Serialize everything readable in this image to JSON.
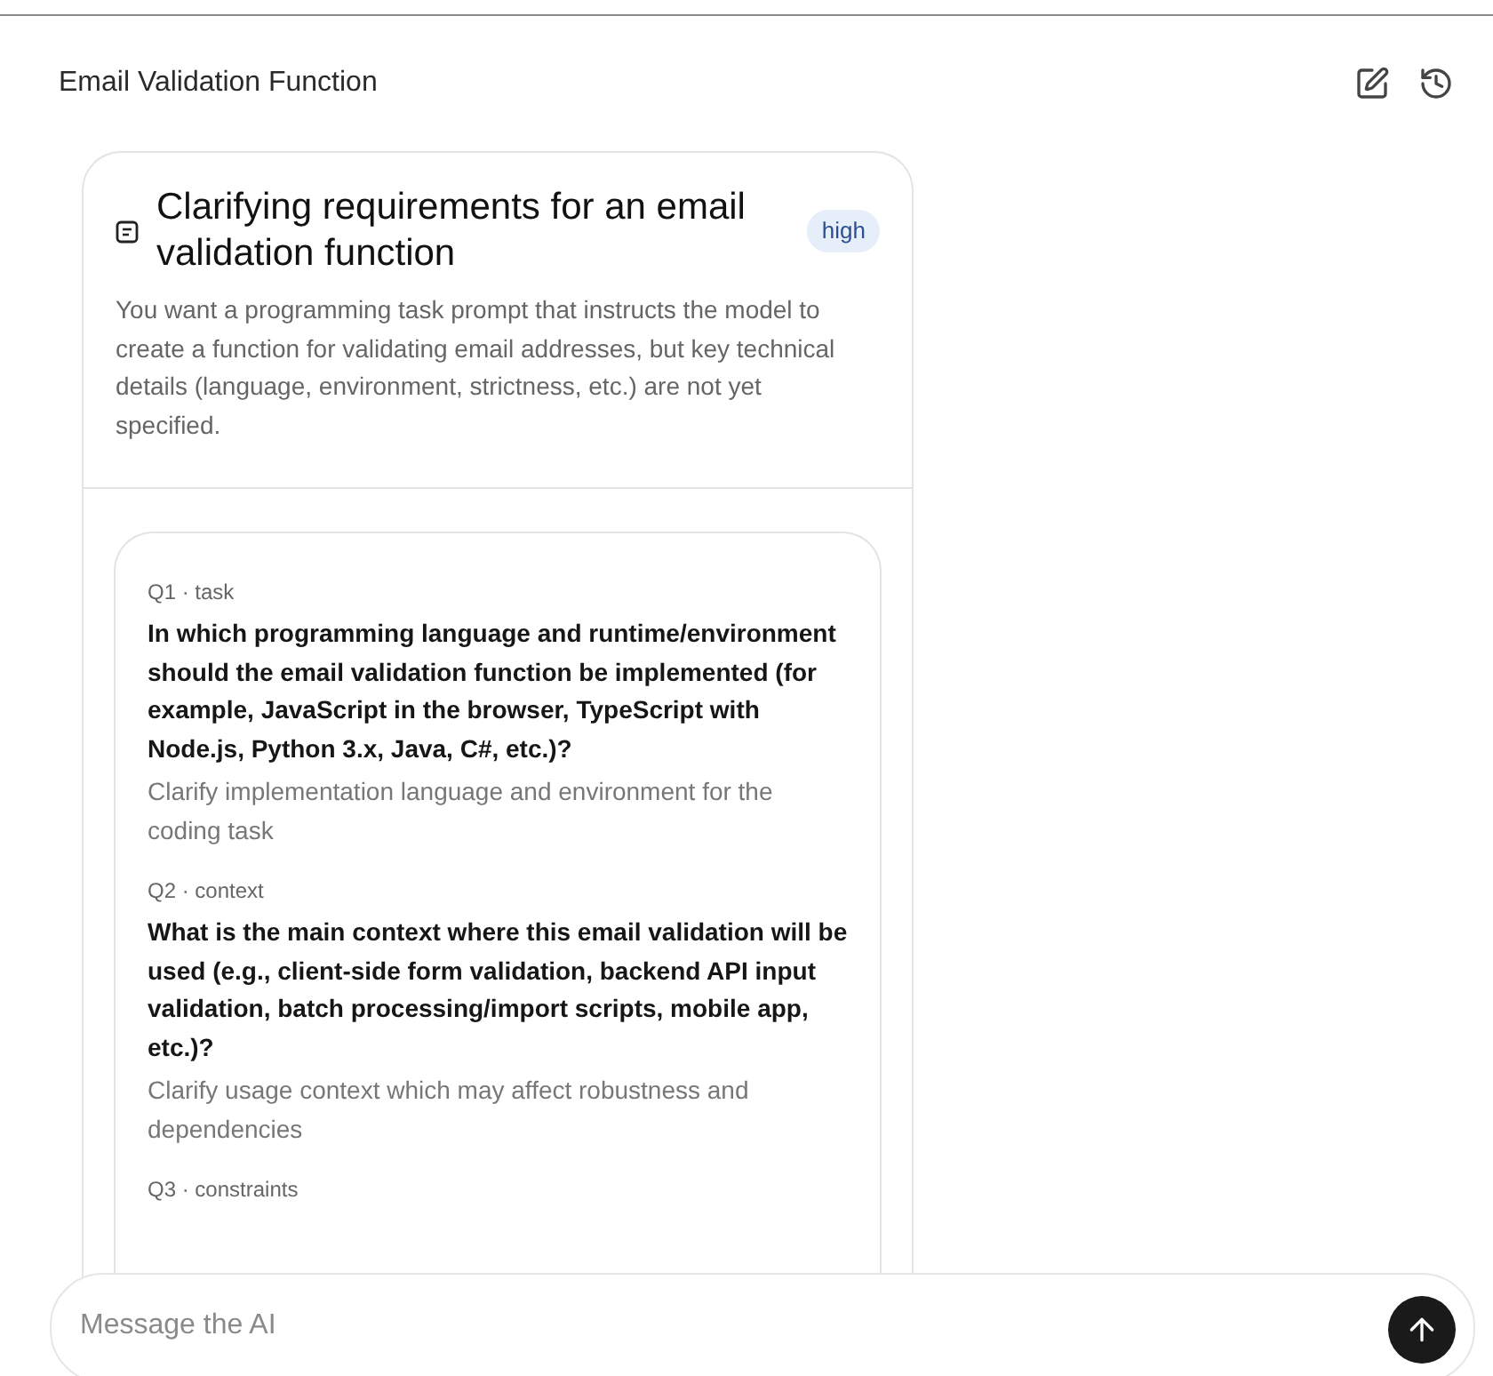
{
  "header": {
    "title": "Email Validation Function"
  },
  "summary": {
    "title": "Clarifying requirements for an email validation function",
    "priority": "high",
    "description": "You want a programming task prompt that instructs the model to create a function for validating email addresses, but key technical details (language, environment, strictness, etc.) are not yet specified."
  },
  "questions": [
    {
      "label": "Q1 · task",
      "question": "In which programming language and runtime/environment should the email validation function be implemented (for example, JavaScript in the browser, TypeScript with Node.js, Python 3.x, Java, C#, etc.)?",
      "note": "Clarify implementation language and environment for the coding task"
    },
    {
      "label": "Q2 · context",
      "question": "What is the main context where this email validation will be used (e.g., client-side form validation, backend API input validation, batch processing/import scripts, mobile app, etc.)?",
      "note": "Clarify usage context which may affect robustness and dependencies"
    },
    {
      "label": "Q3 · constraints"
    }
  ],
  "composer": {
    "placeholder": "Message the AI"
  }
}
